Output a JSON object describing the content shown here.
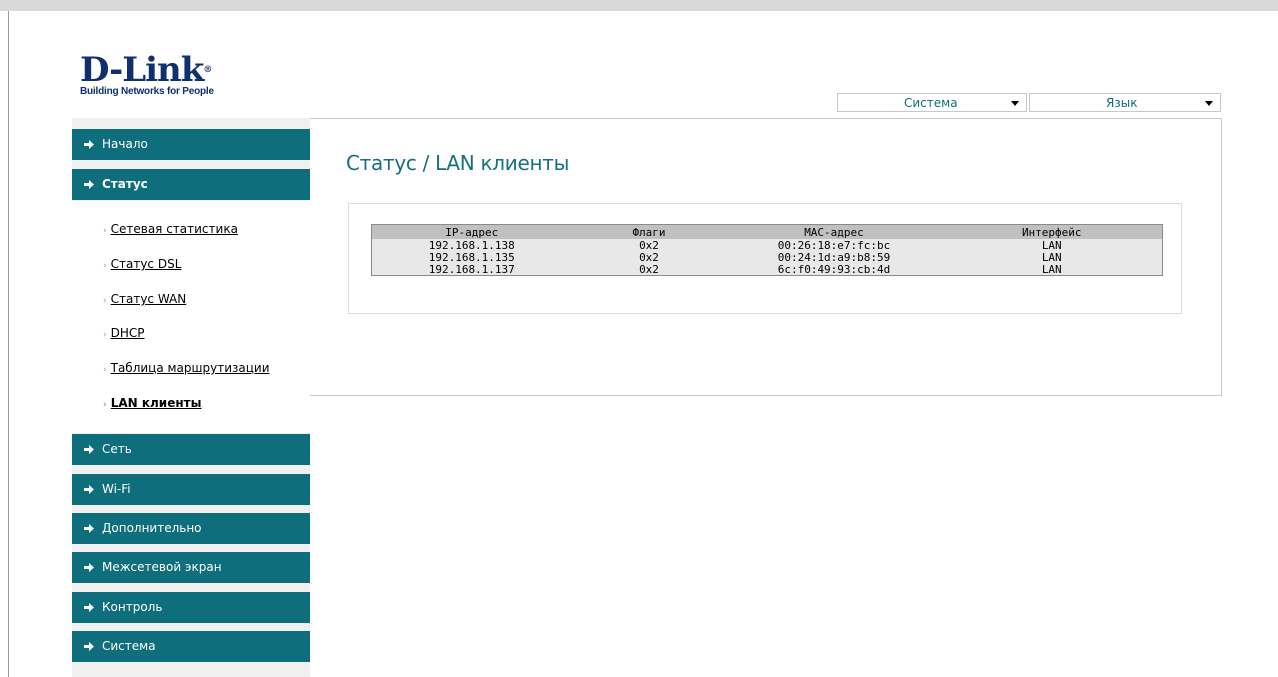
{
  "logo": {
    "name": "D-Link",
    "registered": "®",
    "tagline": "Building Networks for People"
  },
  "header": {
    "system_menu": {
      "selected": "Система"
    },
    "language_menu": {
      "selected": "Язык"
    }
  },
  "page": {
    "title": "Статус / LAN клиенты"
  },
  "table": {
    "columns": [
      "IP-адрес",
      "Флаги",
      "MAC-адрес",
      "Интерфейс"
    ],
    "rows": [
      [
        "192.168.1.138",
        "0x2",
        "00:26:18:e7:fc:bc",
        "LAN"
      ],
      [
        "192.168.1.135",
        "0x2",
        "00:24:1d:a9:b8:59",
        "LAN"
      ],
      [
        "192.168.1.137",
        "0x2",
        "6c:f0:49:93:cb:4d",
        "LAN"
      ]
    ]
  },
  "sidebar": {
    "items": [
      {
        "label": "Начало",
        "icon": "arrow-right-icon"
      },
      {
        "label": "Статус",
        "icon": "arrow-right-icon"
      },
      {
        "label": "Сеть",
        "icon": "arrow-right-icon"
      },
      {
        "label": "Wi-Fi",
        "icon": "arrow-right-icon"
      },
      {
        "label": "Дополнительно",
        "icon": "arrow-right-icon"
      },
      {
        "label": "Межсетевой экран",
        "icon": "arrow-right-icon"
      },
      {
        "label": "Контроль",
        "icon": "arrow-right-icon"
      },
      {
        "label": "Система",
        "icon": "arrow-right-icon"
      }
    ],
    "status_subitems": [
      {
        "label": "Сетевая статистика"
      },
      {
        "label": "Статус DSL"
      },
      {
        "label": "Статус WAN"
      },
      {
        "label": "DHCP"
      },
      {
        "label": "Таблица маршрутизации"
      },
      {
        "label": "LAN клиенты"
      }
    ],
    "subitem_marker": "›"
  },
  "colors": {
    "nav_bg": "#0e6e7b",
    "title_color": "#15717e",
    "logo_color": "#0f2f6d"
  }
}
